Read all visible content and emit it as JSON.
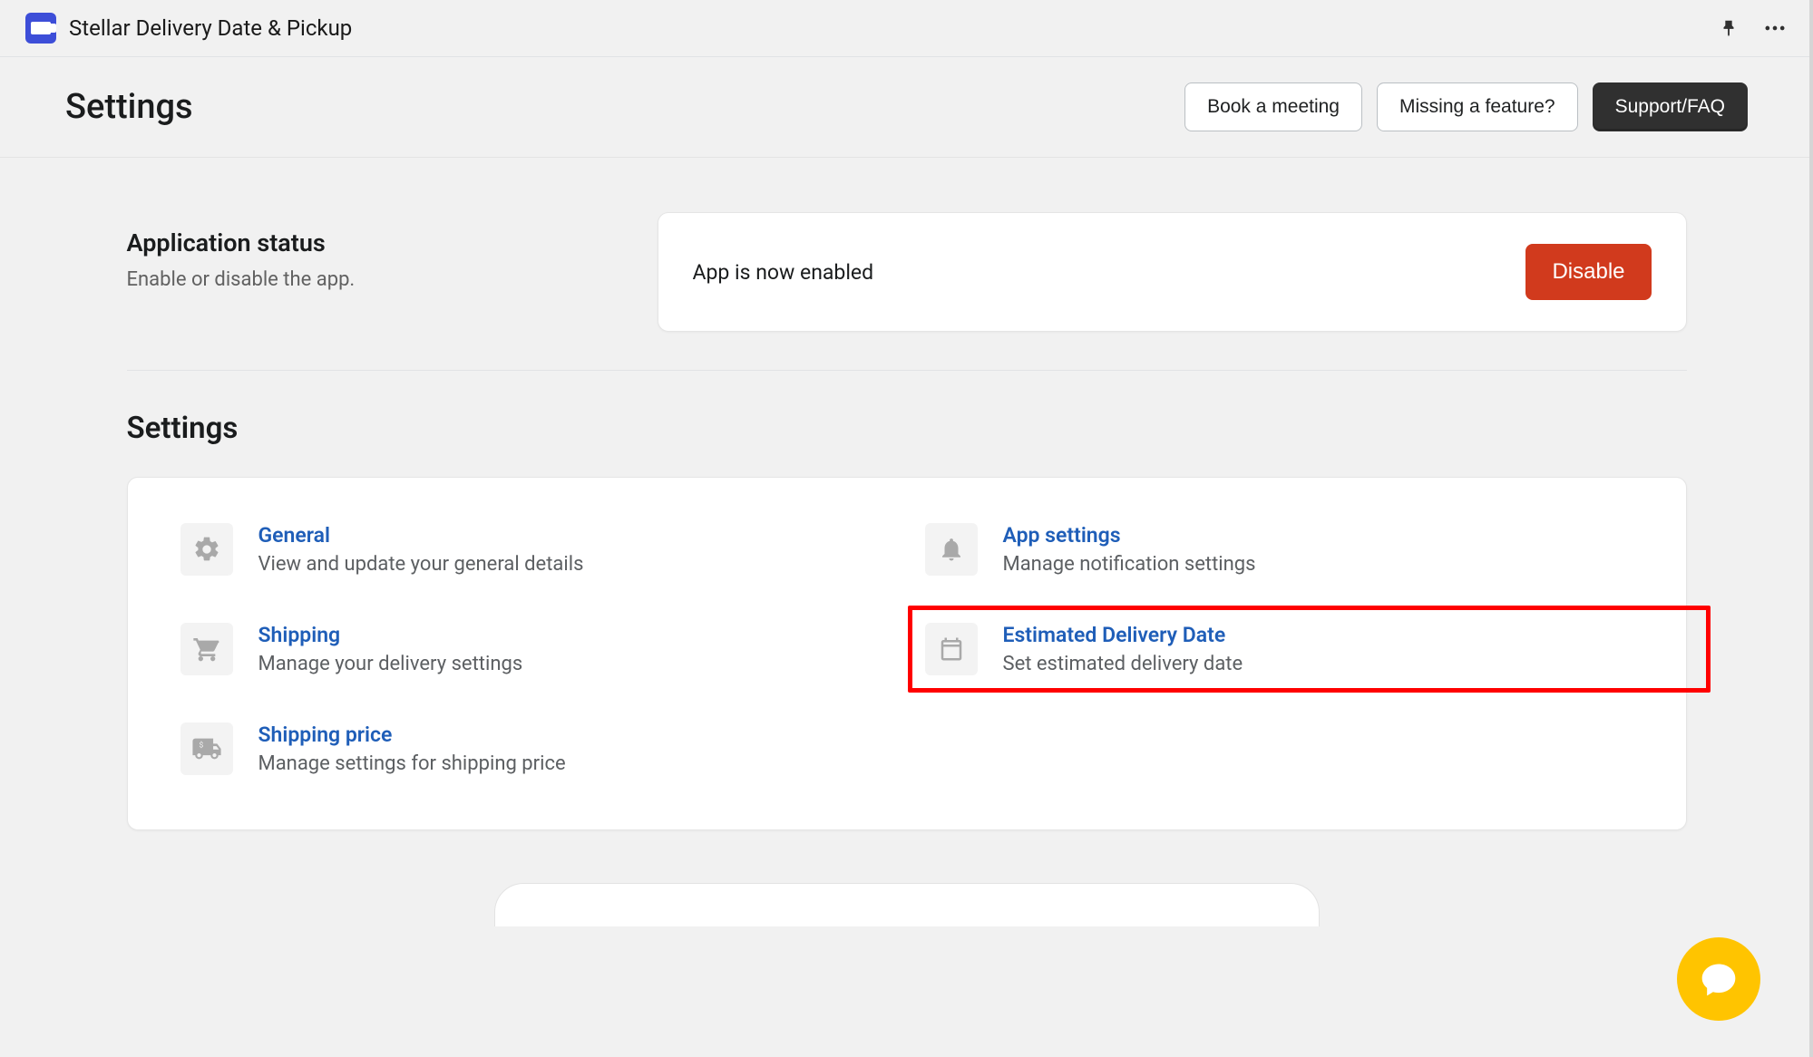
{
  "app": {
    "name": "Stellar Delivery Date & Pickup"
  },
  "header": {
    "title": "Settings",
    "book_meeting_label": "Book a meeting",
    "missing_feature_label": "Missing a feature?",
    "support_label": "Support/FAQ"
  },
  "status": {
    "heading": "Application status",
    "sub": "Enable or disable the app.",
    "card_text": "App is now enabled",
    "disable_label": "Disable"
  },
  "settings": {
    "heading": "Settings",
    "items": [
      {
        "title": "General",
        "desc": "View and update your general details",
        "icon": "gear"
      },
      {
        "title": "App settings",
        "desc": "Manage notification settings",
        "icon": "bell"
      },
      {
        "title": "Shipping",
        "desc": "Manage your delivery settings",
        "icon": "cart"
      },
      {
        "title": "Estimated Delivery Date",
        "desc": "Set estimated delivery date",
        "icon": "calendar",
        "highlight": true
      },
      {
        "title": "Shipping price",
        "desc": "Manage settings for shipping price",
        "icon": "truck"
      }
    ]
  }
}
